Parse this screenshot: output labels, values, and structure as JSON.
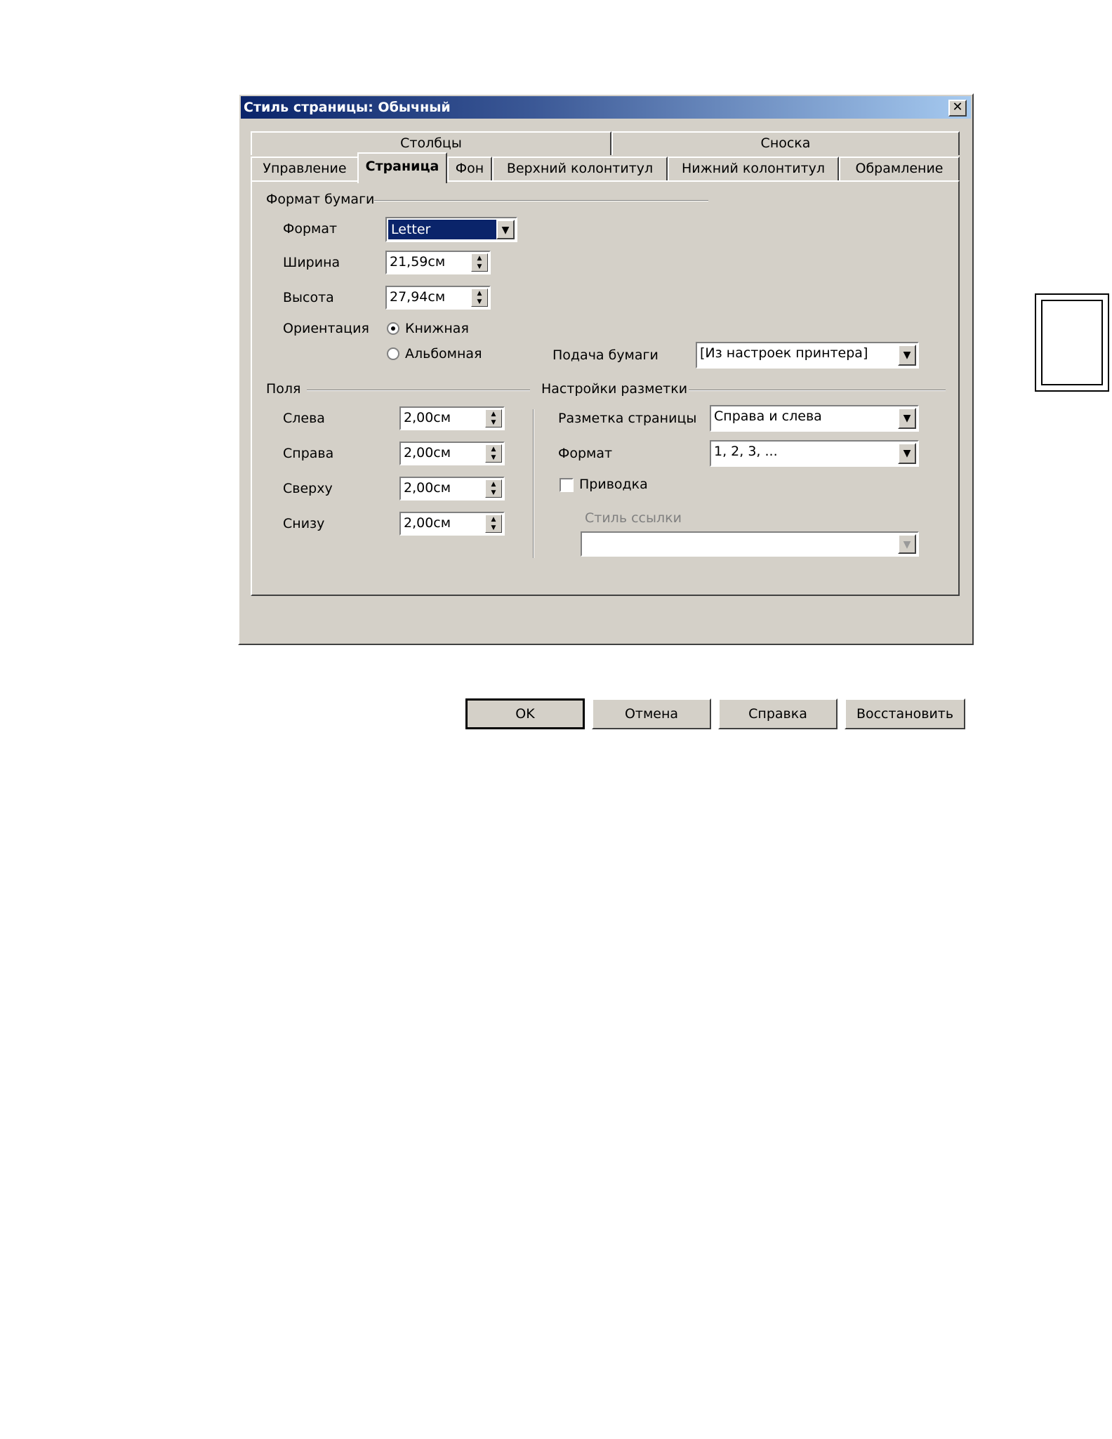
{
  "dialog": {
    "title": "Стиль страницы: Обычный",
    "close_glyph": "✕"
  },
  "tabs_row1": [
    "Столбцы",
    "Сноска"
  ],
  "tabs_row2": [
    "Управление",
    "Страница",
    "Фон",
    "Верхний колонтитул",
    "Нижний колонтитул",
    "Обрамление"
  ],
  "active_tab": "Страница",
  "paper": {
    "group_label": "Формат бумаги",
    "format_label": "Формат",
    "format_value": "Letter",
    "width_label": "Ширина",
    "width_value": "21,59см",
    "height_label": "Высота",
    "height_value": "27,94см",
    "orientation_label": "Ориентация",
    "portrait_label": "Книжная",
    "landscape_label": "Альбомная",
    "orientation_selected": "Книжная",
    "tray_label": "Подача бумаги",
    "tray_value": "[Из настроек принтера]"
  },
  "margins": {
    "group_label": "Поля",
    "left_label": "Слева",
    "left_value": "2,00см",
    "right_label": "Справа",
    "right_value": "2,00см",
    "top_label": "Сверху",
    "top_value": "2,00см",
    "bottom_label": "Снизу",
    "bottom_value": "2,00см"
  },
  "layout": {
    "group_label": "Настройки разметки",
    "page_layout_label": "Разметка страницы",
    "page_layout_value": "Справа и слева",
    "format_label": "Формат",
    "format_value": "1, 2, 3, ...",
    "register_label": "Приводка",
    "register_checked": false,
    "reference_style_label": "Стиль ссылки",
    "reference_style_value": ""
  },
  "buttons": {
    "ok": "OK",
    "cancel": "Отмена",
    "help": "Справка",
    "reset": "Восстановить"
  },
  "colors": {
    "dialog_bg": "#d4d0c8",
    "title_start": "#0a246a",
    "title_end": "#a6caf0",
    "selection": "#0a246a"
  }
}
